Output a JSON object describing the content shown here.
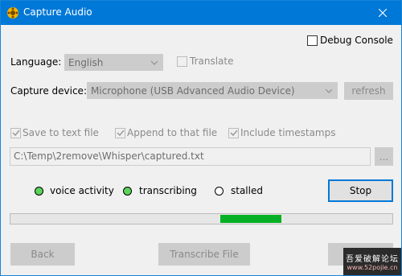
{
  "window": {
    "title": "Capture Audio"
  },
  "debug_console": {
    "label": "Debug Console",
    "checked": false
  },
  "language": {
    "label": "Language:",
    "value": "English"
  },
  "translate": {
    "label": "Translate",
    "checked": false
  },
  "capture_device": {
    "label": "Capture device:",
    "value": "Microphone (USB Advanced Audio Device)",
    "refresh_label": "refresh"
  },
  "save_options": {
    "save_to_file": {
      "label": "Save to text file",
      "checked": true
    },
    "append": {
      "label": "Append to that file",
      "checked": true
    },
    "timestamps": {
      "label": "Include timestamps",
      "checked": true
    }
  },
  "file_path": {
    "value": "C:\\Temp\\2remove\\Whisper\\captured.txt",
    "browse_label": "..."
  },
  "status": {
    "voice_activity": {
      "label": "voice activity",
      "active": true
    },
    "transcribing": {
      "label": "transcribing",
      "active": true
    },
    "stalled": {
      "label": "stalled",
      "active": false
    }
  },
  "stop_label": "Stop",
  "progress": {
    "start_fraction": 0.55,
    "end_fraction": 0.71
  },
  "footer": {
    "back_label": "Back",
    "transcribe_label": "Transcribe File"
  },
  "watermark": {
    "line1": "吾爱破解论坛",
    "line2": "www.52pojie.cn"
  },
  "colors": {
    "title_bar": "#0078d7",
    "led_on": "#5ad45a",
    "progress_fill": "#06b025"
  }
}
